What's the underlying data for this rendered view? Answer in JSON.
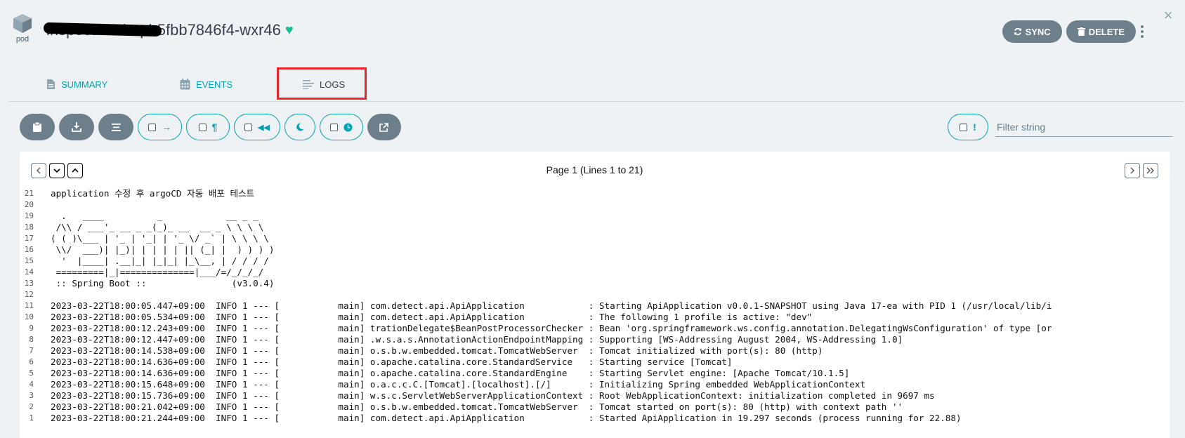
{
  "header": {
    "kind_label": "pod",
    "pod_name": "inspect-and-api-5fbb7846f4-wxr46",
    "sync_label": "SYNC",
    "delete_label": "DELETE"
  },
  "tabs": [
    {
      "label": "SUMMARY"
    },
    {
      "label": "EVENTS"
    },
    {
      "label": "LOGS"
    }
  ],
  "filter": {
    "placeholder": "Filter string",
    "value": ""
  },
  "pager": {
    "info": "Page 1 (Lines 1 to 21)"
  },
  "colors": {
    "accent": "#00a2b3",
    "button_dark": "#6d7f8b",
    "healthy": "#18be94",
    "highlight": "#e8262c"
  },
  "log_lines": [
    {
      "no": "21",
      "text": "application 수정 후 argoCD 자동 배포 테스트"
    },
    {
      "no": "20",
      "text": ""
    },
    {
      "no": "19",
      "text": "  .   ____          _            __ _ _"
    },
    {
      "no": "18",
      "text": " /\\\\ / ___'_ __ _ _(_)_ __  __ _ \\ \\ \\ \\"
    },
    {
      "no": "17",
      "text": "( ( )\\___ | '_ | '_| | '_ \\/ _` | \\ \\ \\ \\"
    },
    {
      "no": "16",
      "text": " \\\\/  ___)| |_)| | | | | || (_| |  ) ) ) )"
    },
    {
      "no": "15",
      "text": "  '  |____| .__|_| |_|_| |_\\__, | / / / /"
    },
    {
      "no": "14",
      "text": " =========|_|==============|___/=/_/_/_/"
    },
    {
      "no": "13",
      "text": " :: Spring Boot ::                (v3.0.4)"
    },
    {
      "no": "12",
      "text": ""
    },
    {
      "no": "11",
      "text": "2023-03-22T18:00:05.447+09:00  INFO 1 --- [           main] com.detect.api.ApiApplication            : Starting ApiApplication v0.0.1-SNAPSHOT using Java 17-ea with PID 1 (/usr/local/lib/i"
    },
    {
      "no": "10",
      "text": "2023-03-22T18:00:05.534+09:00  INFO 1 --- [           main] com.detect.api.ApiApplication            : The following 1 profile is active: \"dev\""
    },
    {
      "no": "9",
      "text": "2023-03-22T18:00:12.243+09:00  INFO 1 --- [           main] trationDelegate$BeanPostProcessorChecker : Bean 'org.springframework.ws.config.annotation.DelegatingWsConfiguration' of type [or"
    },
    {
      "no": "8",
      "text": "2023-03-22T18:00:12.447+09:00  INFO 1 --- [           main] .w.s.a.s.AnnotationActionEndpointMapping : Supporting [WS-Addressing August 2004, WS-Addressing 1.0]"
    },
    {
      "no": "7",
      "text": "2023-03-22T18:00:14.538+09:00  INFO 1 --- [           main] o.s.b.w.embedded.tomcat.TomcatWebServer  : Tomcat initialized with port(s): 80 (http)"
    },
    {
      "no": "6",
      "text": "2023-03-22T18:00:14.636+09:00  INFO 1 --- [           main] o.apache.catalina.core.StandardService   : Starting service [Tomcat]"
    },
    {
      "no": "5",
      "text": "2023-03-22T18:00:14.636+09:00  INFO 1 --- [           main] o.apache.catalina.core.StandardEngine    : Starting Servlet engine: [Apache Tomcat/10.1.5]"
    },
    {
      "no": "4",
      "text": "2023-03-22T18:00:15.648+09:00  INFO 1 --- [           main] o.a.c.c.C.[Tomcat].[localhost].[/]       : Initializing Spring embedded WebApplicationContext"
    },
    {
      "no": "3",
      "text": "2023-03-22T18:00:15.736+09:00  INFO 1 --- [           main] w.s.c.ServletWebServerApplicationContext : Root WebApplicationContext: initialization completed in 9697 ms"
    },
    {
      "no": "2",
      "text": "2023-03-22T18:00:21.042+09:00  INFO 1 --- [           main] o.s.b.w.embedded.tomcat.TomcatWebServer  : Tomcat started on port(s): 80 (http) with context path ''"
    },
    {
      "no": "1",
      "text": "2023-03-22T18:00:21.244+09:00  INFO 1 --- [           main] com.detect.api.ApiApplication            : Started ApiApplication in 19.297 seconds (process running for 22.88)"
    }
  ]
}
